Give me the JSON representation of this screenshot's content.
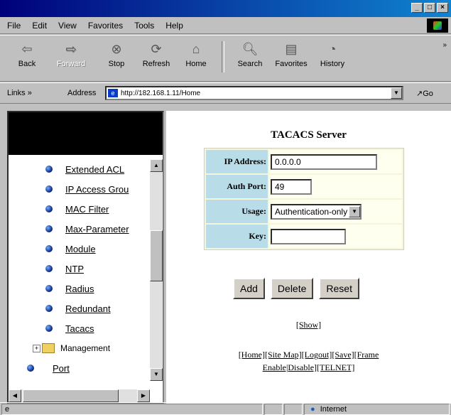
{
  "menu": [
    "File",
    "Edit",
    "View",
    "Favorites",
    "Tools",
    "Help"
  ],
  "toolbar": {
    "back": "Back",
    "forward": "Forward",
    "stop": "Stop",
    "refresh": "Refresh",
    "home": "Home",
    "search": "Search",
    "favorites": "Favorites",
    "history": "History"
  },
  "address": {
    "links_label": "Links »",
    "label": "Address",
    "url": "http://182.168.1.11/Home",
    "go_label": "Go"
  },
  "sidebar": {
    "items": [
      "Extended ACL",
      "IP Access Grou",
      "MAC Filter",
      "Max-Parameter",
      "Module",
      "NTP",
      "Radius",
      "Redundant",
      "Tacacs"
    ],
    "folder": "Management",
    "port": "Port"
  },
  "main": {
    "title": "TACACS Server",
    "fields": {
      "ip_label": "IP Address:",
      "ip_value": "0.0.0.0",
      "port_label": "Auth Port:",
      "port_value": "49",
      "usage_label": "Usage:",
      "usage_value": "Authentication-only",
      "key_label": "Key:",
      "key_value": ""
    },
    "buttons": {
      "add": "Add",
      "delete": "Delete",
      "reset": "Reset"
    },
    "show_link": "[Show]",
    "footer_line1": "[Home][Site Map][Logout][Save][Frame",
    "footer_line2": "Enable|Disable][TELNET]"
  },
  "status": {
    "zone": "Internet"
  }
}
